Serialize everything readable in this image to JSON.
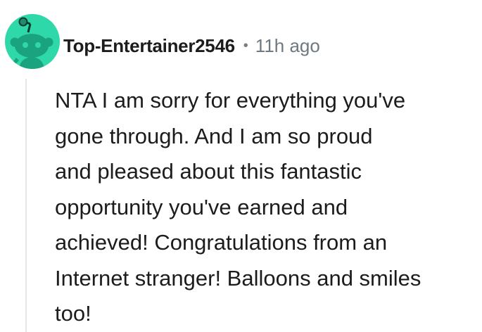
{
  "comment": {
    "author": "Top-Entertainer2546",
    "separator": "•",
    "timestamp": "11h ago",
    "avatar_icon": "snoo-avatar-icon",
    "avatar_color": "#2fd8a8",
    "body_lines": [
      "NTA I am sorry for everything you've",
      "gone through. And I am so proud",
      "and pleased about this fantastic",
      "opportunity you've earned and",
      "achieved! Congratulations from an",
      "Internet stranger! Balloons and smiles",
      "too!"
    ]
  }
}
